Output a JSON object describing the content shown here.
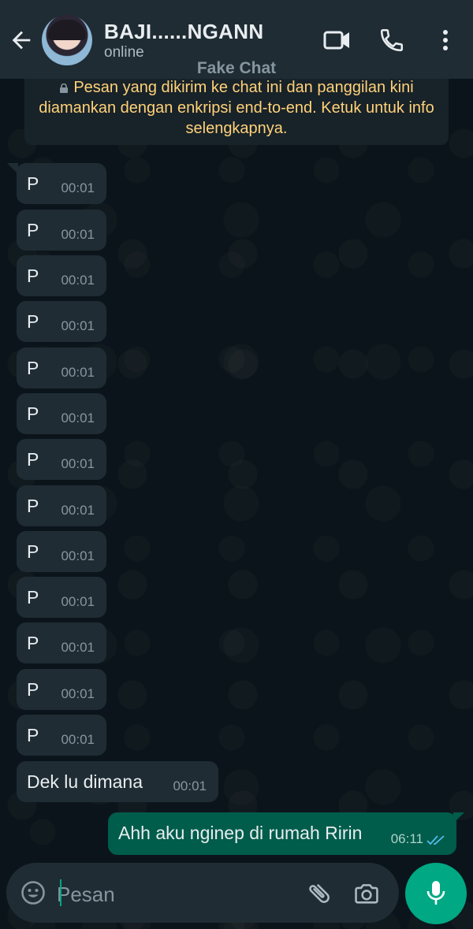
{
  "header": {
    "contact_name": "BAJI......NGANN",
    "status": "online",
    "watermark": "Fake Chat"
  },
  "icons": {
    "back": "arrow-left-icon",
    "video": "video-camera-icon",
    "call": "phone-icon",
    "menu": "more-vertical-icon",
    "lock": "lock-icon",
    "emoji": "emoji-icon",
    "attach": "paperclip-icon",
    "camera": "camera-icon",
    "mic": "mic-icon",
    "read": "double-check-icon"
  },
  "notice": {
    "text": "Pesan yang dikirim ke chat ini dan panggilan kini diamankan dengan enkripsi end-to-end. Ketuk untuk info selengkapnya."
  },
  "messages": [
    {
      "dir": "in",
      "text": "P",
      "time": "00:01"
    },
    {
      "dir": "in",
      "text": "P",
      "time": "00:01"
    },
    {
      "dir": "in",
      "text": "P",
      "time": "00:01"
    },
    {
      "dir": "in",
      "text": "P",
      "time": "00:01"
    },
    {
      "dir": "in",
      "text": "P",
      "time": "00:01"
    },
    {
      "dir": "in",
      "text": "P",
      "time": "00:01"
    },
    {
      "dir": "in",
      "text": "P",
      "time": "00:01"
    },
    {
      "dir": "in",
      "text": "P",
      "time": "00:01"
    },
    {
      "dir": "in",
      "text": "P",
      "time": "00:01"
    },
    {
      "dir": "in",
      "text": "P",
      "time": "00:01"
    },
    {
      "dir": "in",
      "text": "P",
      "time": "00:01"
    },
    {
      "dir": "in",
      "text": "P",
      "time": "00:01"
    },
    {
      "dir": "in",
      "text": "P",
      "time": "00:01"
    },
    {
      "dir": "in",
      "text": "Dek lu dimana",
      "time": "00:01"
    },
    {
      "dir": "out",
      "text": "Ahh aku nginep di rumah Ririn",
      "time": "06:11",
      "status": "read"
    }
  ],
  "composer": {
    "placeholder": "Pesan"
  },
  "colors": {
    "background": "#0b141a",
    "header": "#1f2c34",
    "incoming_bubble": "#1f2c34",
    "outgoing_bubble": "#005c4b",
    "accent": "#00a884",
    "notice_text": "#ffd279",
    "read_ticks": "#53bdeb"
  }
}
